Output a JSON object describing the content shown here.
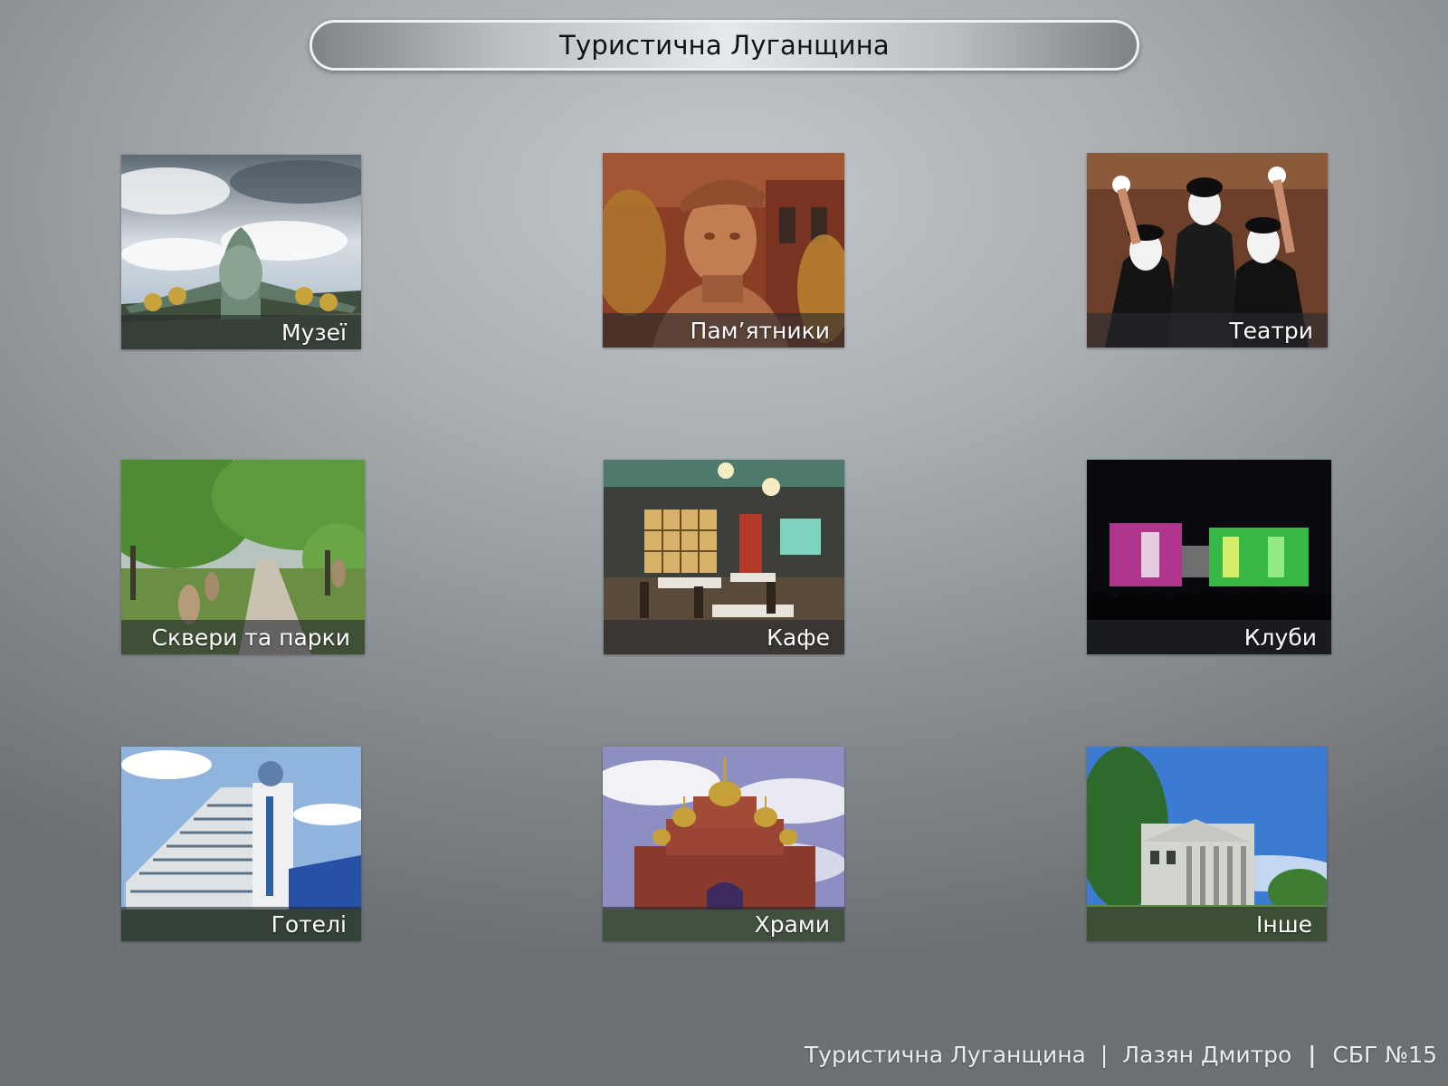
{
  "header": {
    "title": "Туристична Луганщина"
  },
  "tiles": [
    {
      "label": "Музеї",
      "icon": "plane-photo"
    },
    {
      "label": "Пам’ятники",
      "icon": "monument-photo"
    },
    {
      "label": "Театри",
      "icon": "mimes-photo"
    },
    {
      "label": "Сквери та парки",
      "icon": "park-photo"
    },
    {
      "label": "Кафе",
      "icon": "cafe-photo"
    },
    {
      "label": "Клуби",
      "icon": "club-photo"
    },
    {
      "label": "Готелі",
      "icon": "hotel-photo"
    },
    {
      "label": "Храми",
      "icon": "church-photo"
    },
    {
      "label": "Інше",
      "icon": "mansion-photo"
    }
  ],
  "footer": {
    "title": "Туристична  Луганщина",
    "separator": "|",
    "author": "Лазян Дмитро",
    "separator_bold": "|",
    "school": "СБГ №15"
  },
  "colors": {
    "background": "#a9aeb2",
    "caption_band": "#262a2e",
    "text_light": "#ffffff"
  }
}
